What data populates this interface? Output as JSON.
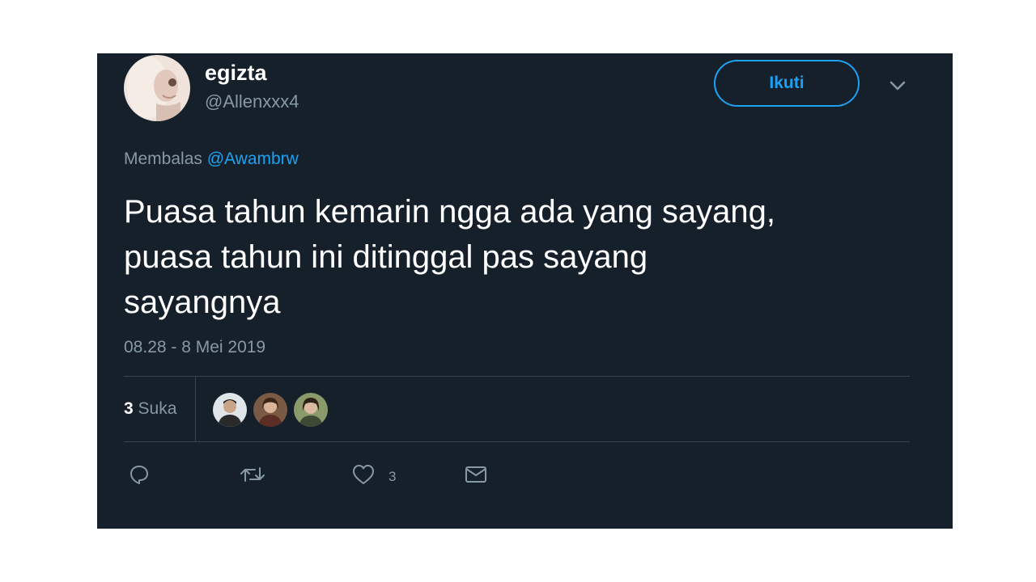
{
  "user": {
    "display_name": "egizta",
    "handle": "@Allenxxx4"
  },
  "header": {
    "follow_label": "Ikuti"
  },
  "reply": {
    "prefix": "Membalas",
    "mention": "@Awambrw"
  },
  "tweet": {
    "line1": "Puasa tahun kemarin ngga ada yang sayang,",
    "line2": "puasa tahun ini ditinggal pas sayang",
    "line3": "sayangnya",
    "timestamp": "08.28 - 8 Mei 2019"
  },
  "stats": {
    "likes_count": "3",
    "likes_label": "Suka"
  },
  "actions": {
    "reply_icon": "reply-icon",
    "retweet_icon": "retweet-icon",
    "like_icon": "heart-icon",
    "like_count": "3",
    "dm_icon": "envelope-icon"
  },
  "colors": {
    "background": "#15202b",
    "accent": "#1da1f2",
    "muted": "#8899a6",
    "divider": "#38444d"
  }
}
